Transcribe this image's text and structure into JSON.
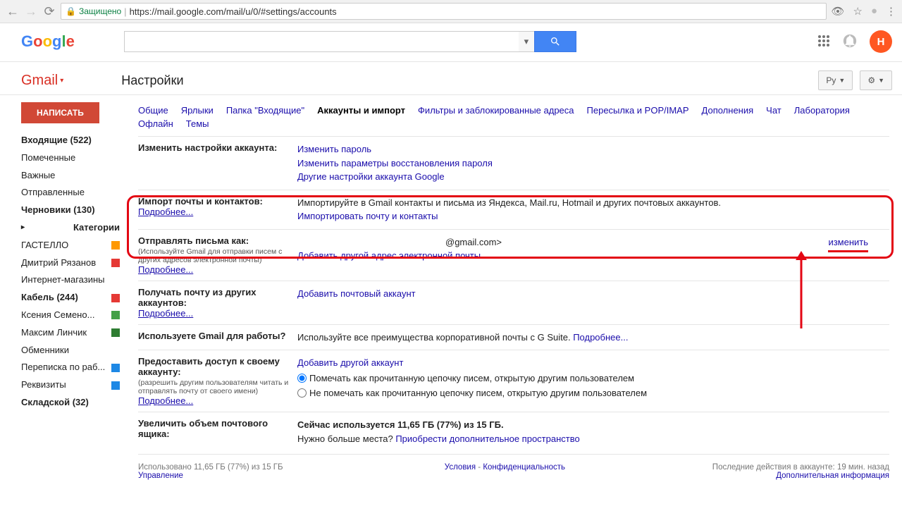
{
  "browser": {
    "secure_label": "Защищено",
    "url": "https://mail.google.com/mail/u/0/#settings/accounts"
  },
  "header": {
    "avatar_letter": "Н"
  },
  "gmail": {
    "brand": "Gmail",
    "settings_title": "Настройки",
    "lang_btn": "Ру"
  },
  "sidebar": {
    "compose": "НАПИСАТЬ",
    "items": [
      {
        "label": "Входящие (522)",
        "bold": true
      },
      {
        "label": "Помеченные"
      },
      {
        "label": "Важные"
      },
      {
        "label": "Отправленные"
      },
      {
        "label": "Черновики (130)",
        "bold": true
      },
      {
        "label": "Категории",
        "bold": true,
        "chev": true
      }
    ],
    "labels": [
      {
        "label": "ГАСТЕЛЛО",
        "swatch": "sw-orange"
      },
      {
        "label": "Дмитрий Рязанов",
        "swatch": "sw-red",
        "truncated": true
      },
      {
        "label": "Интернет-магазины"
      },
      {
        "label": "Кабель (244)",
        "swatch": "sw-red",
        "bold": true
      },
      {
        "label": "Ксения Семено...",
        "swatch": "sw-green",
        "truncated": true
      },
      {
        "label": "Максим Линчик",
        "swatch": "sw-dgreen"
      },
      {
        "label": "Обменники"
      },
      {
        "label": "Переписка по раб...",
        "swatch": "sw-blue"
      },
      {
        "label": "Реквизиты",
        "swatch": "sw-blue"
      },
      {
        "label": "Складской (32)",
        "bold": true,
        "truncated": true
      }
    ]
  },
  "tabs": [
    {
      "label": "Общие"
    },
    {
      "label": "Ярлыки"
    },
    {
      "label": "Папка \"Входящие\""
    },
    {
      "label": "Аккаунты и импорт",
      "active": true
    },
    {
      "label": "Фильтры и заблокированные адреса"
    },
    {
      "label": "Пересылка и POP/IMAP"
    },
    {
      "label": "Дополнения"
    },
    {
      "label": "Чат"
    },
    {
      "label": "Лаборатория"
    },
    {
      "label": "Офлайн"
    },
    {
      "label": "Темы"
    }
  ],
  "rows": {
    "r1": {
      "title": "Изменить настройки аккаунта:",
      "links": [
        "Изменить пароль",
        "Изменить параметры восстановления пароля",
        "Другие настройки аккаунта Google"
      ]
    },
    "r2": {
      "title": "Импорт почты и контактов:",
      "more": "Подробнее...",
      "text": "Импортируйте в Gmail контакты и письма из Яндекса, Mail.ru, Hotmail и других почтовых аккаунтов.",
      "link": "Импортировать почту и контакты"
    },
    "r3": {
      "title": "Отправлять письма как:",
      "sub": "(Используйте Gmail для отправки писем с других адресов электронной почты)",
      "more": "Подробнее...",
      "email": "@gmail.com>",
      "link": "Добавить другой адрес электронной почты",
      "edit": "изменить"
    },
    "r4": {
      "title": "Получать почту из других аккаунтов:",
      "more": "Подробнее...",
      "link": "Добавить почтовый аккаунт"
    },
    "r5": {
      "title": "Используете Gmail для работы?",
      "text": "Используйте все преимущества корпоративной почты с G Suite. ",
      "link": "Подробнее..."
    },
    "r6": {
      "title": "Предоставить доступ к своему аккаунту:",
      "sub": "(разрешить другим пользователям читать и отправлять почту от своего имени)",
      "more": "Подробнее...",
      "link": "Добавить другой аккаунт",
      "opt1": "Помечать как прочитанную цепочку писем, открытую другим пользователем",
      "opt2": "Не помечать как прочитанную цепочку писем, открытую другим пользователем"
    },
    "r7": {
      "title": "Увеличить объем почтового ящика:",
      "text": "Сейчас используется 11,65 ГБ (77%) из 15 ГБ.",
      "text2": "Нужно больше места? ",
      "link": "Приобрести дополнительное пространство"
    }
  },
  "footer": {
    "usage": "Использовано 11,65 ГБ (77%) из 15 ГБ",
    "manage": "Управление",
    "terms": "Условия",
    "dash": " - ",
    "privacy": "Конфиденциальность",
    "activity": "Последние действия в аккаунте: 19 мин. назад",
    "info": "Дополнительная информация"
  }
}
